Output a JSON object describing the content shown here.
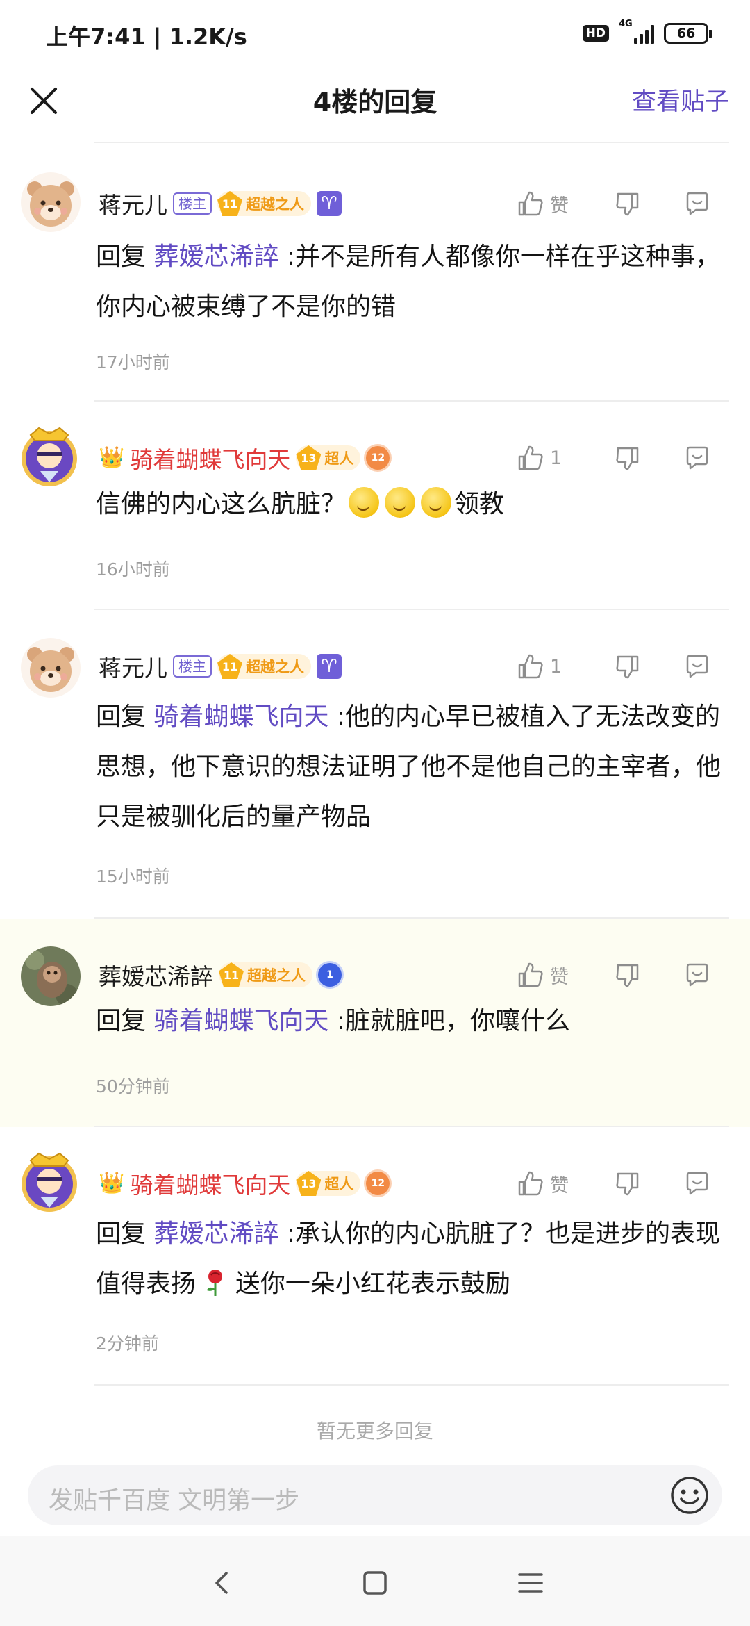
{
  "status_bar": {
    "time": "上午7:41 | 1.2K/s",
    "hd": "HD",
    "network": "4G",
    "battery": "66"
  },
  "nav": {
    "title": "4楼的回复",
    "view_post": "查看贴子"
  },
  "replies": [
    {
      "username": "蒋元儿",
      "owner_tag": "楼主",
      "level": "11",
      "level_name": "超越之人",
      "zodiac": "♈",
      "like": "赞",
      "reply_prefix": "回复",
      "mention": "葬嫒芯浠誶",
      "text": " :并不是所有人都像你一样在乎这种事，你内心被束缚了不是你的错",
      "time": "17小时前"
    },
    {
      "username": "骑着蝴蝶飞向天",
      "level": "13",
      "level_name": "超人",
      "medal": "12",
      "like": "1",
      "text_before": "信佛的内心这么肮脏？",
      "text_after": "领教",
      "time": "16小时前"
    },
    {
      "username": "蒋元儿",
      "owner_tag": "楼主",
      "level": "11",
      "level_name": "超越之人",
      "zodiac": "♈",
      "like": "1",
      "reply_prefix": "回复",
      "mention": "骑着蝴蝶飞向天",
      "text": " :他的内心早已被植入了无法改变的思想，他下意识的想法证明了他不是他自己的主宰者，他只是被驯化后的量产物品",
      "time": "15小时前"
    },
    {
      "username": "葬嫒芯浠誶",
      "level": "11",
      "level_name": "超越之人",
      "medal": "1",
      "like": "赞",
      "reply_prefix": "回复",
      "mention": "骑着蝴蝶飞向天",
      "text": " :脏就脏吧，你嚷什么",
      "time": "50分钟前"
    },
    {
      "username": "骑着蝴蝶飞向天",
      "level": "13",
      "level_name": "超人",
      "medal": "12",
      "like": "赞",
      "reply_prefix": "回复",
      "mention": "葬嫒芯浠誶",
      "text_before": " :承认你的内心肮脏了？也是进步的表现 值得表扬 ",
      "text_after": " 送你一朵小红花表示鼓励",
      "time": "2分钟前"
    }
  ],
  "no_more": "暂无更多回复",
  "input": {
    "placeholder": "发贴千百度 文明第一步"
  },
  "icons": {
    "close": "close-icon",
    "like": "thumb-up-icon",
    "dislike": "thumb-down-icon",
    "comment": "comment-icon",
    "emoji": "smiley-icon",
    "rose": "rose-icon"
  }
}
